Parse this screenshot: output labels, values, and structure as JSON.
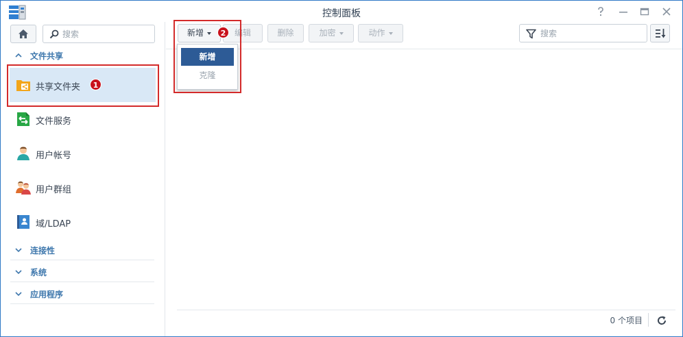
{
  "window": {
    "title": "控制面板",
    "controls": [
      "help-icon",
      "minimize-icon",
      "maximize-icon",
      "close-icon"
    ]
  },
  "sidebar": {
    "search_placeholder": "搜索",
    "sections": [
      {
        "label": "文件共享",
        "expanded": true
      },
      {
        "label": "连接性",
        "expanded": false
      },
      {
        "label": "系统",
        "expanded": false
      },
      {
        "label": "应用程序",
        "expanded": false
      }
    ],
    "items": [
      {
        "label": "共享文件夹",
        "icon": "shared-folder-icon",
        "selected": true
      },
      {
        "label": "文件服务",
        "icon": "file-services-icon"
      },
      {
        "label": "用户帐号",
        "icon": "user-icon"
      },
      {
        "label": "用户群组",
        "icon": "group-icon"
      },
      {
        "label": "域/LDAP",
        "icon": "domain-ldap-icon"
      }
    ]
  },
  "toolbar": {
    "create_label": "新增",
    "edit_label": "编辑",
    "delete_label": "删除",
    "encrypt_label": "加密",
    "action_label": "动作",
    "filter_placeholder": "搜索"
  },
  "dropdown": {
    "items": [
      {
        "label": "新增",
        "state": "highlighted"
      },
      {
        "label": "克隆",
        "state": "disabled"
      }
    ]
  },
  "footer": {
    "count_text": "0 个项目"
  },
  "annotations": {
    "badge_1": "1",
    "badge_2": "2"
  },
  "colors": {
    "selected_bg": "#d9e8f6",
    "section_label": "#3f78ad",
    "menu_highlight": "#2d5b96",
    "annotation_red": "#d32a2a",
    "badge_red": "#c8111b",
    "window_border": "#2f78c6"
  }
}
